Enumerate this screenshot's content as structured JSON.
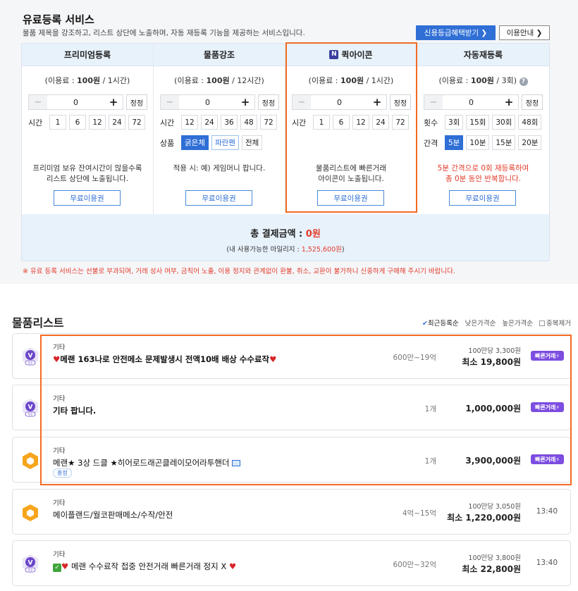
{
  "top": {
    "title": "유료등록 서비스",
    "desc": "물품 제목을 강조하고, 리스트 상단에 노출하며, 자동 재등록 기능을 제공하는 서비스입니다.",
    "credit_button": "신용등급혜택받기 ❯",
    "guide_button": "이용안내 ❯"
  },
  "columns": [
    {
      "head": "프리미엄등록",
      "price_prefix": "(이용료 : ",
      "price": "100원",
      "price_suffix": " / 1시간)",
      "value": "0",
      "set": "정정",
      "row1_label": "시간",
      "row1": [
        "1",
        "6",
        "12",
        "24",
        "72"
      ],
      "note1": "프리미엄 보유 잔여시간이 많을수록",
      "note2": "리스트 상단에 노출됩니다.",
      "free": "무료이용권"
    },
    {
      "head": "물품강조",
      "price_prefix": "(이용료 : ",
      "price": "100원",
      "price_suffix": " / 12시간)",
      "value": "0",
      "set": "정정",
      "row1_label": "시간",
      "row1": [
        "12",
        "24",
        "36",
        "48",
        "72"
      ],
      "row2_label": "상품",
      "row2": [
        "굵은체",
        "파란펜",
        "전체"
      ],
      "note1": "적용 시: 예) 게임머니 팝니다.",
      "note2": "",
      "free": "무료이용권"
    },
    {
      "head": "퀵아이콘",
      "head_icon": "N",
      "price_prefix": "(이용료 : ",
      "price": "100원",
      "price_suffix": " / 1시간)",
      "value": "0",
      "set": "정정",
      "row1_label": "시간",
      "row1": [
        "1",
        "6",
        "12",
        "24",
        "72"
      ],
      "note1": "물품리스트에 빠른거래",
      "note2": "아이콘이 노출됩니다.",
      "free": "무료이용권"
    },
    {
      "head": "자동재등록",
      "price_prefix": "(이용료 : ",
      "price": "100원",
      "price_suffix": " / 3회)",
      "value": "0",
      "set": "정정",
      "row1_label": "횟수",
      "row1": [
        "3회",
        "15회",
        "30회",
        "48회"
      ],
      "row2_label": "간격",
      "row2": [
        "5분",
        "10분",
        "15분",
        "20분"
      ],
      "note1": "5분 간격으로 0회 재등록하여",
      "note2": "총 0분 동안 반복합니다.",
      "free": "무료이용권"
    }
  ],
  "total": {
    "label": "총 결제금액 : ",
    "amount": "0원",
    "mileage_label": "(내 사용가능한 마일리지 : ",
    "mileage": "1,525,600원",
    "mileage_suffix": ")"
  },
  "warning": "※ 유료 등록 서비스는 선불로 부과되며, 거래 성사 여부, 금칙어 노출, 이용 정지와 관계없이 환불, 취소, 교환이 불가하니 신중하게 구매해 주시기 바랍니다.",
  "list": {
    "title": "물품리스트",
    "sort": [
      "최근등록순",
      "낮은가격순",
      "높은가격순",
      "중복제거"
    ],
    "items": [
      {
        "badge": "V",
        "badge_sub": "우수",
        "category": "기타",
        "title": "메랜 163나로 안전메소 문제발생시 전액10배 배상 수수료작",
        "range": "600만~19억",
        "unit": "100만당 3,300원",
        "price": "최소 19,800원",
        "fast": "빠른거래"
      },
      {
        "badge": "V",
        "badge_sub": "우수",
        "category": "기타",
        "title": "기타 팝니다.",
        "range": "1개",
        "price": "1,000,000원",
        "fast": "빠른거래"
      },
      {
        "badge": "hex",
        "category": "기타",
        "title": "메랜★ 3상 드클 ★히어로드래곤클레이모어라투핸더",
        "tag": "흥정",
        "range": "1개",
        "price": "3,900,000원",
        "fast": "빠른거래"
      },
      {
        "badge": "hex",
        "category": "기타",
        "title": "메이플랜드/월코판매메소/수작/안전",
        "range": "4억~15억",
        "unit": "100만당 3,050원",
        "price": "최소 1,220,000원",
        "time": "13:40"
      },
      {
        "badge": "V",
        "badge_sub": "우수",
        "category": "기타",
        "title": "메랜 수수료작 접중 안전거래 빠른거래 정지 X",
        "range": "600만~32억",
        "unit": "100만당 3,800원",
        "price": "최소 22,800원",
        "time": "13:40"
      }
    ]
  },
  "colors": {
    "accent": "#2f6fd6",
    "highlight": "#f36b23",
    "red": "#e23b2b",
    "fast_badge": "#7c4de0"
  }
}
